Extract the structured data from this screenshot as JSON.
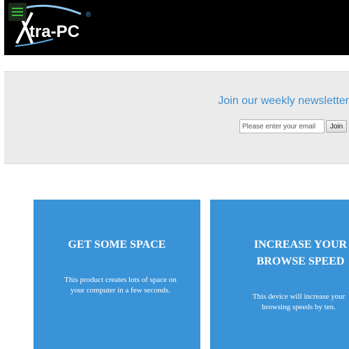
{
  "header": {
    "logo_text": "Xtra-PC",
    "logo_registered_mark": "®",
    "menu_icon": "hamburger-menu-icon",
    "colors": {
      "background": "#000000",
      "menu_accent": "#3fbf3f"
    }
  },
  "newsletter": {
    "title": "Join our weekly newsletter",
    "email_placeholder": "Please enter your email",
    "join_label": "Join",
    "colors": {
      "background": "#ebebeb",
      "title": "#3f8fcf"
    }
  },
  "cards": [
    {
      "title": "GET SOME SPACE",
      "text": "This product creates lots of space on your computer in a few seconds."
    },
    {
      "title": "INCREASE YOUR BROWSE SPEED",
      "text": "This device will increase your browsing speeds by ten."
    }
  ],
  "colors": {
    "card_background": "#3a93d7"
  }
}
